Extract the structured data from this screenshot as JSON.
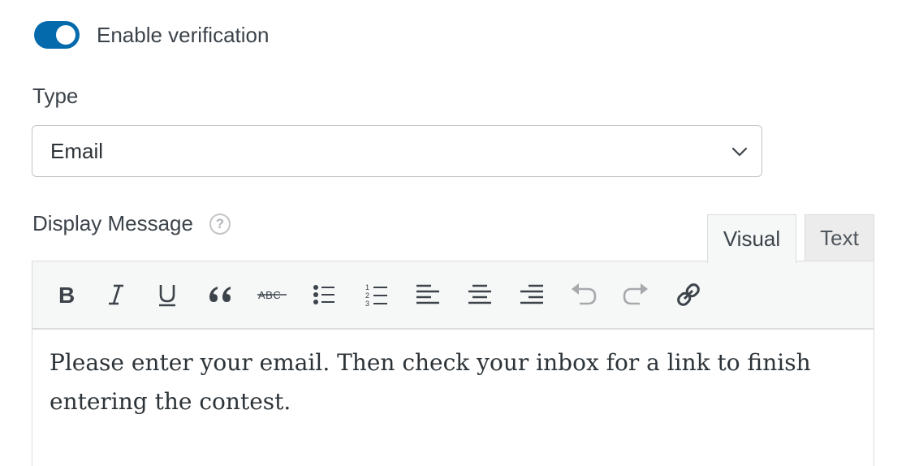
{
  "verification": {
    "toggle_on": true,
    "label": "Enable verification"
  },
  "type": {
    "label": "Type",
    "selected": "Email"
  },
  "display_message": {
    "label": "Display Message",
    "help_icon": "question-circle-icon",
    "tabs": {
      "visual": "Visual",
      "text": "Text"
    },
    "active_tab": "Visual",
    "toolbar_icons": [
      "bold-icon",
      "italic-icon",
      "underline-icon",
      "blockquote-icon",
      "strikethrough-icon",
      "bulleted-list-icon",
      "numbered-list-icon",
      "align-left-icon",
      "align-center-icon",
      "align-right-icon",
      "undo-icon",
      "redo-icon",
      "link-icon"
    ],
    "content": "Please enter your email. Then check your inbox for a link to finish entering the contest."
  },
  "colors": {
    "toggle_accent": "#056aab",
    "text": "#3c434a",
    "border": "#c3c4c7",
    "toolbar_bg": "#f6f7f7"
  }
}
